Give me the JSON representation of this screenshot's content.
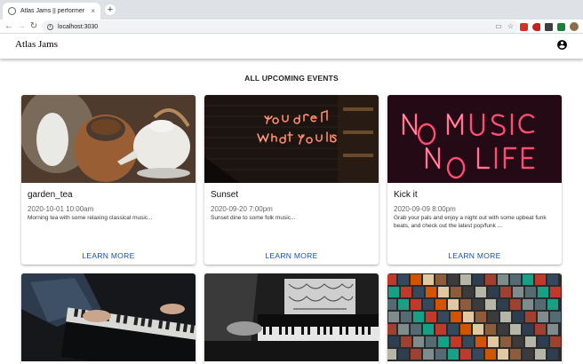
{
  "browser": {
    "tab_title": "Atlas Jams || performer",
    "tab_close": "×",
    "new_tab": "+",
    "url": "localhost:3030",
    "back": "←",
    "forward": "→",
    "reload": "↻"
  },
  "appbar": {
    "brand": "Atlas Jams",
    "account_icon": "account-circle-icon"
  },
  "main": {
    "section_title": "ALL UPCOMING EVENTS",
    "learn_more_label": "LEARN MORE",
    "events": [
      {
        "name": "garden_tea",
        "datetime": "2020-10-01 10:00am",
        "description": "Morning tea with some relaxing classical music...",
        "image": "teapot-image"
      },
      {
        "name": "Sunset",
        "datetime": "2020-09-20 7:00pm",
        "description": "Sunset dine to some folk music...",
        "image": "neon-you-are-what-you-listen-to-image"
      },
      {
        "name": "Kick it",
        "datetime": "2020-09-09 8:00pm",
        "description": "Grab your pals and enjoy a night out with some upbeat funk beats, and check out the latest pop/funk ...",
        "image": "neon-no-music-no-life-image"
      },
      {
        "image": "piano-hands-image"
      },
      {
        "image": "piano-bw-image"
      },
      {
        "image": "record-wall-image"
      }
    ]
  },
  "colors": {
    "accent": "#1c4db0",
    "neon_pink": "#ff6a8a",
    "neon_orange": "#ffb27a"
  }
}
